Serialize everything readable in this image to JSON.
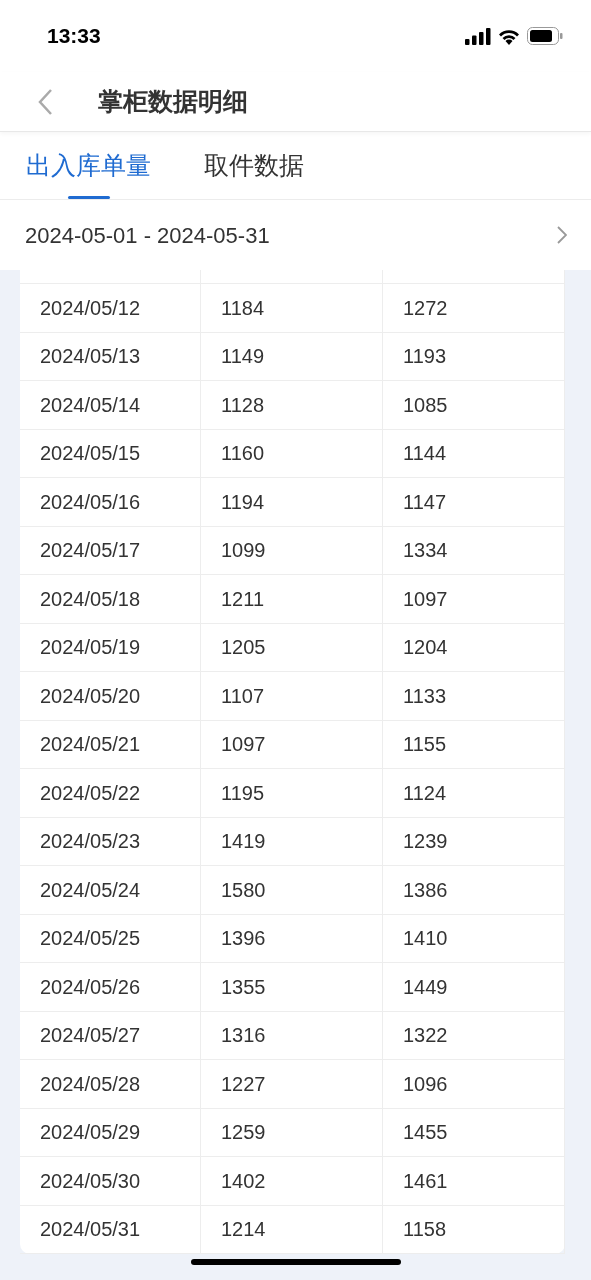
{
  "status_bar": {
    "time": "13:33"
  },
  "nav": {
    "title": "掌柜数据明细"
  },
  "tabs": [
    {
      "label": "出入库单量",
      "selected": true
    },
    {
      "label": "取件数据",
      "selected": false
    }
  ],
  "date_range": {
    "value": "2024-05-01 - 2024-05-31"
  },
  "table": {
    "rows": [
      [
        "2024/05/12",
        "1184",
        "1272"
      ],
      [
        "2024/05/13",
        "1149",
        "1193"
      ],
      [
        "2024/05/14",
        "1128",
        "1085"
      ],
      [
        "2024/05/15",
        "1160",
        "1144"
      ],
      [
        "2024/05/16",
        "1194",
        "1147"
      ],
      [
        "2024/05/17",
        "1099",
        "1334"
      ],
      [
        "2024/05/18",
        "1211",
        "1097"
      ],
      [
        "2024/05/19",
        "1205",
        "1204"
      ],
      [
        "2024/05/20",
        "1107",
        "1133"
      ],
      [
        "2024/05/21",
        "1097",
        "1155"
      ],
      [
        "2024/05/22",
        "1195",
        "1124"
      ],
      [
        "2024/05/23",
        "1419",
        "1239"
      ],
      [
        "2024/05/24",
        "1580",
        "1386"
      ],
      [
        "2024/05/25",
        "1396",
        "1410"
      ],
      [
        "2024/05/26",
        "1355",
        "1449"
      ],
      [
        "2024/05/27",
        "1316",
        "1322"
      ],
      [
        "2024/05/28",
        "1227",
        "1096"
      ],
      [
        "2024/05/29",
        "1259",
        "1455"
      ],
      [
        "2024/05/30",
        "1402",
        "1461"
      ],
      [
        "2024/05/31",
        "1214",
        "1158"
      ]
    ]
  }
}
